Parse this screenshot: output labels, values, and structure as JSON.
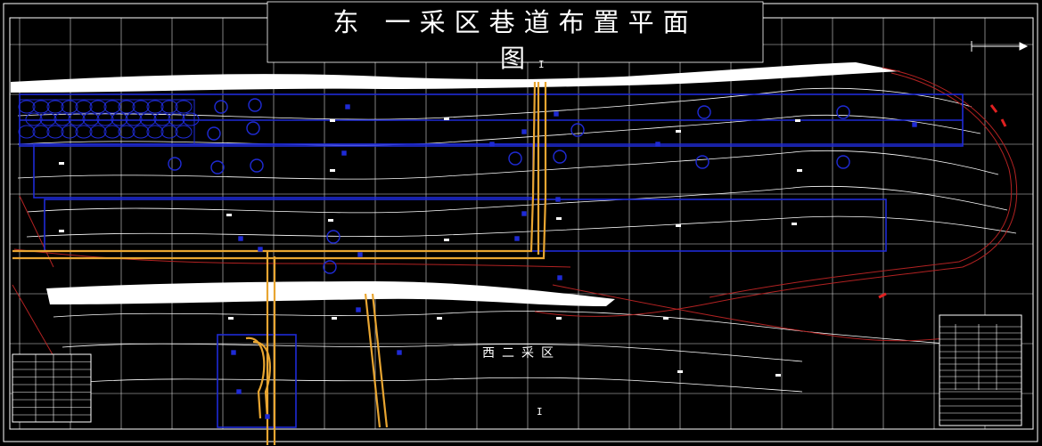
{
  "title": {
    "line1": "东  一采区巷道布置平面",
    "line2": "图"
  },
  "area_label": "西二采区",
  "point_labels": {
    "top": "I",
    "bottom": "I"
  },
  "colors": {
    "background": "#000000",
    "grid": "#ffffff",
    "roadway": "#1f2bd6",
    "main_roadway": "#e8a531",
    "boundary": "#b22222",
    "contour": "#ffffff"
  }
}
